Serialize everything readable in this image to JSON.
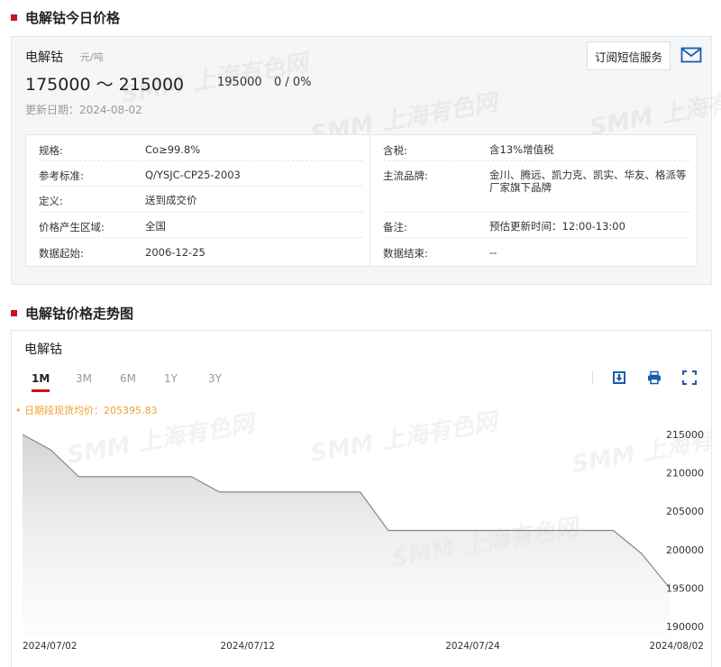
{
  "section1": {
    "title": "电解钴今日价格"
  },
  "price": {
    "product": "电解钴",
    "unit": "元/吨",
    "range": "175000 ～ 215000",
    "average": "195000",
    "change": "0 / 0%",
    "update_date": "更新日期：2024-08-02",
    "subscribe_label": "订阅短信服务"
  },
  "specs_left": [
    {
      "label": "规格:",
      "value": "Co≥99.8%"
    },
    {
      "label": "参考标准:",
      "value": "Q/YSJC-CP25-2003"
    },
    {
      "label": "定义:",
      "value": "送到成交价"
    },
    {
      "label": "价格产生区域:",
      "value": "全国"
    },
    {
      "label": "数据起始:",
      "value": "2006-12-25"
    }
  ],
  "specs_right": [
    {
      "label": "含税:",
      "value": "含13%增值税"
    },
    {
      "label": "主流品牌:",
      "value": "金川、腾远、凯力克、凯实、华友、格派等厂家旗下品牌"
    },
    {
      "label": "备注:",
      "value": "预估更新时间：12:00-13:00"
    },
    {
      "label": "数据结束:",
      "value": "--"
    }
  ],
  "section2": {
    "title": "电解钴价格走势图"
  },
  "chart_header": {
    "name": "电解钴",
    "tabs": [
      "1M",
      "3M",
      "6M",
      "1Y",
      "3Y"
    ],
    "active_tab": "1M",
    "avg_label": "• 日期段现货均价：205395.83"
  },
  "watermark": "SMM 上海有色网",
  "colors": {
    "accent": "#c8161d",
    "line": "#888888",
    "avg": "#f0a030",
    "icon": "#1a5bb0"
  },
  "icons": [
    "mail-icon",
    "download-icon",
    "print-icon",
    "fullscreen-icon"
  ],
  "chart_data": {
    "type": "area",
    "x": [
      "2024-07-02",
      "2024-07-03",
      "2024-07-04",
      "2024-07-05",
      "2024-07-08",
      "2024-07-09",
      "2024-07-10",
      "2024-07-11",
      "2024-07-12",
      "2024-07-15",
      "2024-07-16",
      "2024-07-17",
      "2024-07-18",
      "2024-07-19",
      "2024-07-22",
      "2024-07-23",
      "2024-07-24",
      "2024-07-25",
      "2024-07-26",
      "2024-07-29",
      "2024-07-30",
      "2024-07-31",
      "2024-08-01",
      "2024-08-02"
    ],
    "series": [
      {
        "values": [
          215000,
          213000,
          209500,
          209500,
          209500,
          209500,
          209500,
          207500,
          207500,
          207500,
          207500,
          207500,
          207500,
          202500,
          202500,
          202500,
          202500,
          202500,
          202500,
          202500,
          202500,
          202500,
          199500,
          195000
        ]
      }
    ],
    "x_tick_labels": [
      "2024/07/02",
      "2024/07/12",
      "2024/07/24",
      "2024/08/02"
    ],
    "y_ticks": [
      190000,
      195000,
      200000,
      205000,
      210000,
      215000
    ],
    "ylim": [
      190000,
      215000
    ],
    "y_axis_position": "right",
    "grid": false,
    "title": "电解钴"
  }
}
